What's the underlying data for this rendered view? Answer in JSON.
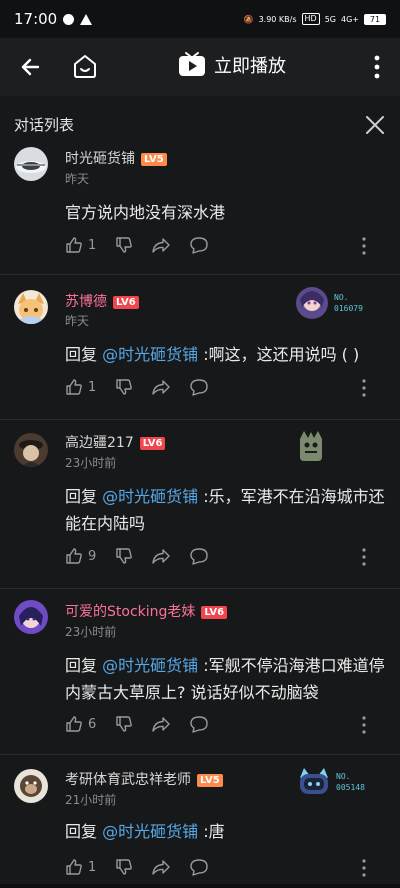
{
  "status": {
    "time": "17:00",
    "net_speed": "3.90 KB/s",
    "hd": "HD",
    "sig1": "5G",
    "sig2": "4G+",
    "battery": "71"
  },
  "appbar": {
    "play_label": "立即播放"
  },
  "dialog": {
    "title": "对话列表"
  },
  "comments": [
    {
      "username": "时光砸货铺",
      "level": "LV5",
      "time": "昨天",
      "prefix": "",
      "mention": "",
      "text": "官方说内地没有深水港",
      "likes": "1"
    },
    {
      "username": "苏博德",
      "level": "LV6",
      "time": "昨天",
      "prefix": "回复 ",
      "mention": "@时光砸货铺",
      "text": " :啊这，这还用说吗 ( )",
      "likes": "1",
      "badge_no": "NO.",
      "badge_num": "016079"
    },
    {
      "username": "高边疆217",
      "level": "LV6",
      "time": "23小时前",
      "prefix": "回复 ",
      "mention": "@时光砸货铺",
      "text": " :乐，军港不在沿海城市还能在内陆吗",
      "likes": "9"
    },
    {
      "username": "可爱的Stocking老妹",
      "level": "LV6",
      "time": "23小时前",
      "prefix": "回复 ",
      "mention": "@时光砸货铺",
      "text": " :军舰不停沿海港口难道停内蒙古大草原上? 说话好似不动脑袋",
      "likes": "6"
    },
    {
      "username": "考研体育武忠祥老师",
      "level": "LV5",
      "time": "21小时前",
      "prefix": "回复 ",
      "mention": "@时光砸货铺",
      "text": " :唐",
      "likes": "1",
      "badge_no": "NO.",
      "badge_num": "005148"
    }
  ],
  "colors": {
    "mention": "#57a8e6",
    "lv5": "#ff8a4c",
    "lv6": "#f1464d",
    "vip_name": "#fb7299"
  }
}
